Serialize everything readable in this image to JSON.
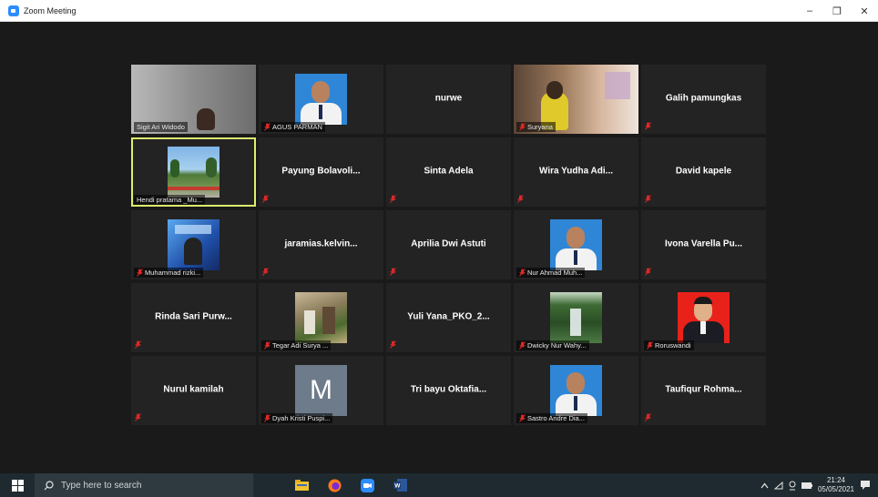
{
  "window": {
    "title": "Zoom Meeting",
    "controls": {
      "minimize": "–",
      "maximize": "❐",
      "close": "✕"
    }
  },
  "participants": [
    {
      "name": "Sigit Ari Widodo",
      "video": "webcam-room",
      "muted": false,
      "active": false
    },
    {
      "name": "AGUS PARMAN",
      "video": "portrait-blue",
      "muted": true,
      "active": false
    },
    {
      "name": "nurwe",
      "video": "none",
      "muted": false,
      "active": false
    },
    {
      "name": "Suryana",
      "video": "webcam-room-2",
      "muted": true,
      "active": false
    },
    {
      "name": "Galih pamungkas",
      "video": "none",
      "muted": true,
      "active": false
    },
    {
      "name": "Hendi pratama _Mu...",
      "video": "landscape-park",
      "muted": false,
      "active": true
    },
    {
      "name": "Payung Bolavoli...",
      "video": "none",
      "muted": true,
      "active": false
    },
    {
      "name": "Sinta Adela",
      "video": "none",
      "muted": true,
      "active": false
    },
    {
      "name": "Wira Yudha Adi...",
      "video": "none",
      "muted": true,
      "active": false
    },
    {
      "name": "David kapele",
      "video": "none",
      "muted": true,
      "active": false
    },
    {
      "name": "Muhammad rizki...",
      "video": "poster-blue",
      "muted": true,
      "active": false
    },
    {
      "name": "jaramias.kelvin...",
      "video": "none",
      "muted": true,
      "active": false
    },
    {
      "name": "Aprilia Dwi Astuti",
      "video": "none",
      "muted": true,
      "active": false
    },
    {
      "name": "Nur Ahmad Muh...",
      "video": "portrait-blue",
      "muted": true,
      "active": false
    },
    {
      "name": "Ivona Varella Pu...",
      "video": "none",
      "muted": true,
      "active": false
    },
    {
      "name": "Rinda Sari Purw...",
      "video": "none",
      "muted": true,
      "active": false
    },
    {
      "name": "Tegar Adi Surya ...",
      "video": "outdoor-crowd",
      "muted": true,
      "active": false
    },
    {
      "name": "Yuli Yana_PKO_2...",
      "video": "none",
      "muted": true,
      "active": false
    },
    {
      "name": "Dwicky Nur Wahy...",
      "video": "waterfall",
      "muted": true,
      "active": false
    },
    {
      "name": "Roruswandi",
      "video": "portrait-red",
      "muted": true,
      "active": false
    },
    {
      "name": "Nurul kamilah",
      "video": "none",
      "muted": true,
      "active": false
    },
    {
      "name": "Dyah Kristi Puspi...",
      "video": "initial",
      "initial": "M",
      "muted": true,
      "active": false
    },
    {
      "name": "Tri bayu Oktafia...",
      "video": "none",
      "muted": false,
      "active": false
    },
    {
      "name": "Sastro Andre Dia...",
      "video": "portrait-blue",
      "muted": true,
      "active": false
    },
    {
      "name": "Taufiqur Rohma...",
      "video": "none",
      "muted": true,
      "active": false
    }
  ],
  "taskbar": {
    "search_placeholder": "Type here to search",
    "time": "21:24",
    "date": "05/05/2021",
    "apps": [
      "file-explorer-icon",
      "firefox-icon",
      "zoom-icon",
      "word-icon"
    ]
  },
  "colors": {
    "active_speaker": "#ddef6e",
    "tile_bg": "#232323",
    "meeting_bg": "#1a1a1a",
    "mute": "#e02828"
  }
}
